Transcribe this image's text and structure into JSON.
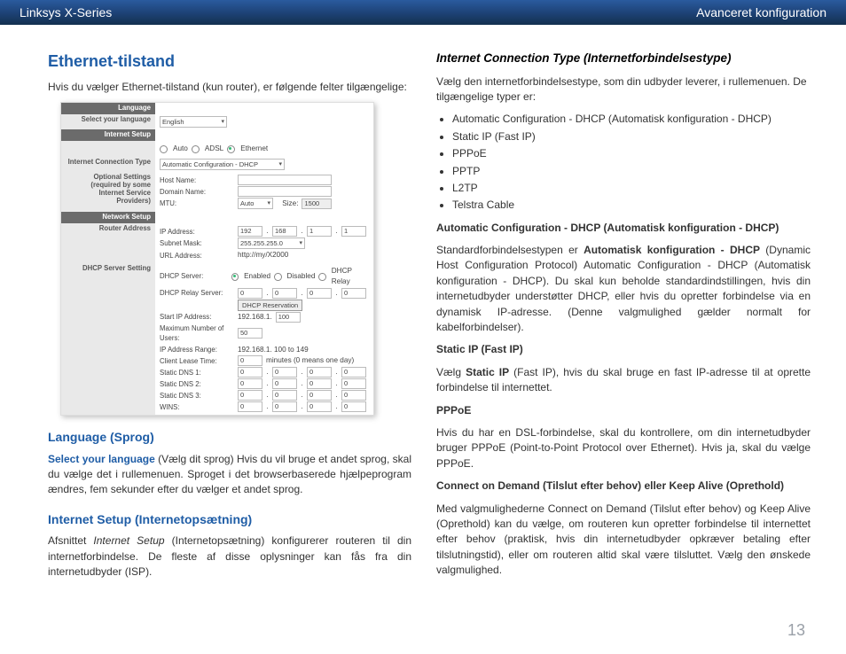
{
  "header": {
    "left": "Linksys X-Series",
    "right": "Avanceret konfiguration"
  },
  "left": {
    "h2": "Ethernet-tilstand",
    "intro": "Hvis du vælger Ethernet-tilstand (kun router), er følgende felter tilgængelige:",
    "lang_h": "Language (Sprog)",
    "lang_lead": "Select your language",
    "lang_lead2": " (Vælg dit sprog)  Hvis du vil bruge et andet sprog, skal du vælge det i rullemenuen. Sproget i det browserbaserede hjælpeprogram ændres, fem sekunder efter du vælger et andet sprog.",
    "setup_h": "Internet Setup (Internetopsætning)",
    "setup_lead_em": "Internet Setup",
    "setup_p_pre": "Afsnittet ",
    "setup_p_post": " (Internetopsætning) konfigurerer routeren til din internetforbindelse. De fleste af disse oplysninger kan fås fra din internetudbyder (ISP)."
  },
  "shot": {
    "head_lang": "Language",
    "lbl_sel_lang": "Select your language",
    "val_lang": "English",
    "head_is": "Internet Setup",
    "radios": {
      "auto": "Auto",
      "adsl": "ADSL",
      "eth": "Ethernet"
    },
    "lbl_ict": "Internet Connection Type",
    "val_ict": "Automatic Configuration - DHCP",
    "lbl_opt": "Optional Settings (required by some Internet Service Providers)",
    "lbl_host": "Host Name:",
    "lbl_domain": "Domain Name:",
    "lbl_mtu": "MTU:",
    "val_mtu": "Auto",
    "lbl_size": "Size:",
    "val_size": "1500",
    "head_ns": "Network Setup",
    "lbl_ra": "Router Address",
    "lbl_ip": "IP Address:",
    "ip": [
      "192",
      "168",
      "1",
      "1"
    ],
    "lbl_sm": "Subnet Mask:",
    "sm": "255.255.255.0",
    "lbl_url": "URL Address:",
    "url": "http://my/X2000",
    "lbl_dhcp_set": "DHCP Server Setting",
    "lbl_dhcp": "DHCP Server:",
    "dhcp_opts": {
      "en": "Enabled",
      "dis": "Disabled",
      "relay": "DHCP Relay"
    },
    "lbl_relay": "DHCP Relay Server:",
    "btn_res": "DHCP Reservation",
    "lbl_start": "Start IP Address:",
    "val_start_pre": "192.168.1.",
    "val_start": "100",
    "lbl_max": "Maximum Number of Users:",
    "val_max": "50",
    "lbl_range": "IP Address Range:",
    "val_range": "192.168.1. 100 to 149",
    "lbl_lease": "Client Lease Time:",
    "val_lease": "0",
    "val_lease_txt": "minutes (0 means one day)",
    "lbl_d1": "Static DNS 1:",
    "lbl_d2": "Static DNS 2:",
    "lbl_d3": "Static DNS 3:",
    "lbl_wins": "WINS:",
    "zeros": [
      "0",
      "0",
      "0",
      "0"
    ]
  },
  "right": {
    "h": "Internet Connection Type (Internetforbindelsestype)",
    "intro": "Vælg den internetforbindelsestype, som din udbyder leverer, i rullemenuen. De tilgængelige typer er:",
    "types": [
      "Automatic Configuration - DHCP (Automatisk konfiguration - DHCP)",
      "Static IP (Fast IP)",
      "PPPoE",
      "PPTP",
      "L2TP",
      "Telstra Cable"
    ],
    "dhcp_h": "Automatic Configuration - DHCP (Automatisk konfiguration - DHCP)",
    "dhcp_p_pre": "Standardforbindelsestypen er ",
    "dhcp_p_bold": "Automatisk konfiguration - DHCP",
    "dhcp_p_post": " (Dynamic Host Configuration Protocol) Automatic Configuration - DHCP (Automatisk konfiguration - DHCP). Du skal kun beholde standardindstillingen, hvis din internetudbyder understøtter DHCP, eller hvis du opretter forbindelse via en dynamisk IP-adresse. (Denne valgmulighed gælder normalt for kabelforbindelser).",
    "static_h": "Static IP (Fast IP)",
    "static_pre": "Vælg ",
    "static_bold": "Static IP",
    "static_post": " (Fast IP), hvis du skal bruge en fast IP-adresse til at oprette forbindelse til internettet.",
    "pppoe_h": "PPPoE",
    "pppoe_p": "Hvis du har en DSL-forbindelse, skal du kontrollere, om din internetudbyder bruger PPPoE (Point-to-Point Protocol over Ethernet). Hvis ja, skal du vælge PPPoE.",
    "cod_h": "Connect on Demand (Tilslut efter behov) eller Keep Alive (Oprethold)",
    "cod_p": "Med valgmulighederne Connect on Demand (Tilslut efter behov) og Keep Alive (Oprethold) kan du vælge, om routeren kun opretter forbindelse til internettet efter behov (praktisk, hvis din internetudbyder opkræver betaling efter tilslutningstid), eller om routeren altid skal være tilsluttet. Vælg den ønskede valgmulighed."
  },
  "page_num": "13"
}
